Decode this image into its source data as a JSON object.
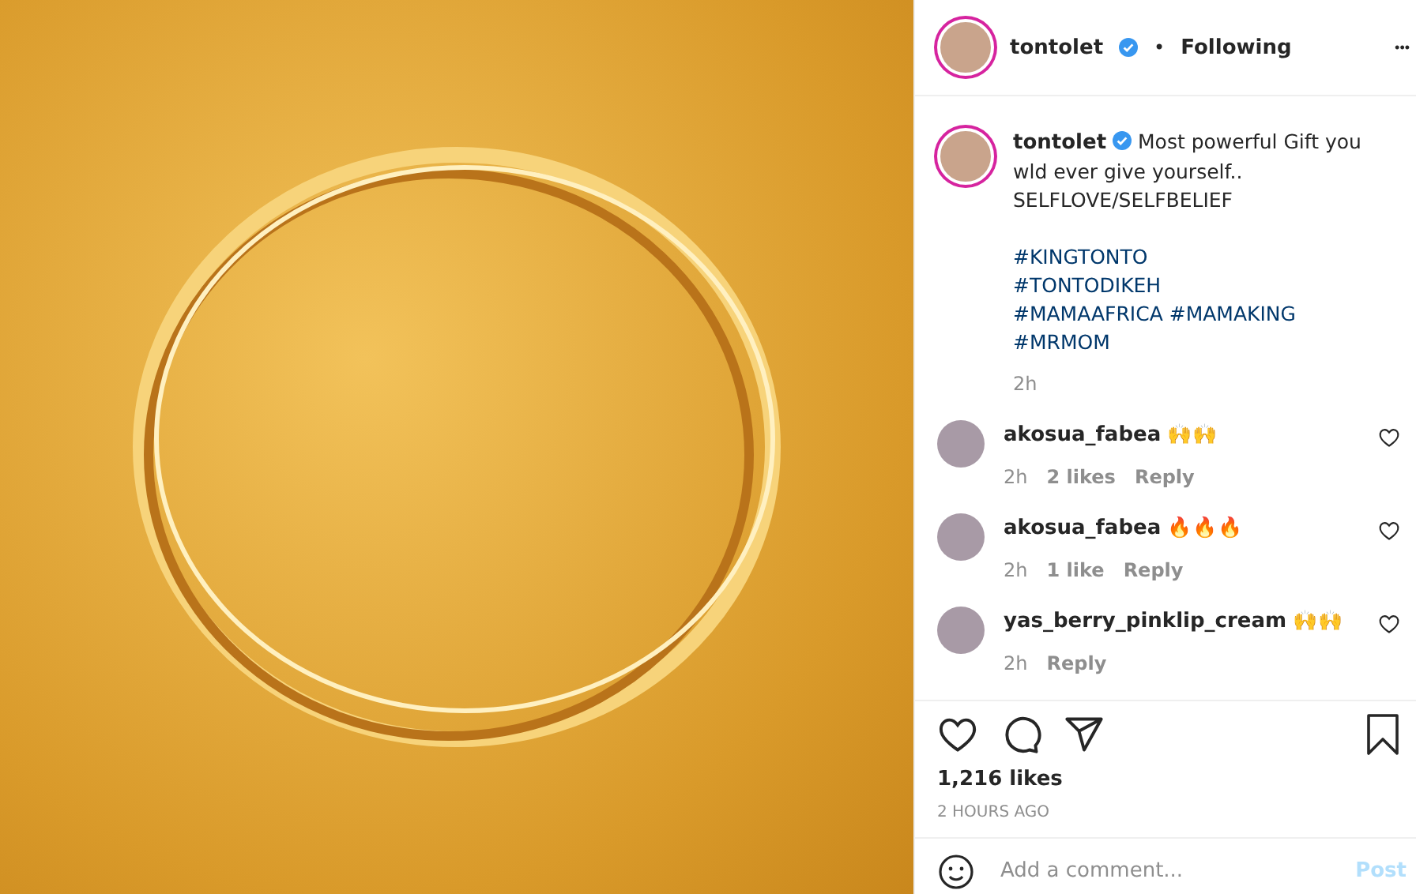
{
  "post_image": {
    "kind": "gold-ring-graphic"
  },
  "header": {
    "username": "tontolet",
    "verified": true,
    "separator": "•",
    "follow": "Following",
    "more": "•••"
  },
  "caption": {
    "username": "tontolet",
    "verified": true,
    "text": "Most powerful Gift you wld ever give yourself..",
    "lines": [
      "SELFLOVE/SELFBELIEF"
    ],
    "hashtags": [
      "#KINGTONTO",
      "#TONTODIKEH",
      "#MAMAAFRICA #MAMAKING",
      "#MRMOM"
    ],
    "time": "2h"
  },
  "comments": [
    {
      "username": "akosua_fabea",
      "text": "🙌🙌",
      "time": "2h",
      "likes": "2 likes",
      "reply": "Reply"
    },
    {
      "username": "akosua_fabea",
      "text": "🔥🔥🔥",
      "time": "2h",
      "likes": "1 like",
      "reply": "Reply"
    },
    {
      "username": "yas_berry_pinklip_cream",
      "text": "🙌🙌",
      "time": "2h",
      "reply": "Reply"
    }
  ],
  "likes": "1,216 likes",
  "posted": "2 HOURS AGO",
  "add_comment": {
    "placeholder": "Add a comment...",
    "post": "Post",
    "disabled": true
  }
}
